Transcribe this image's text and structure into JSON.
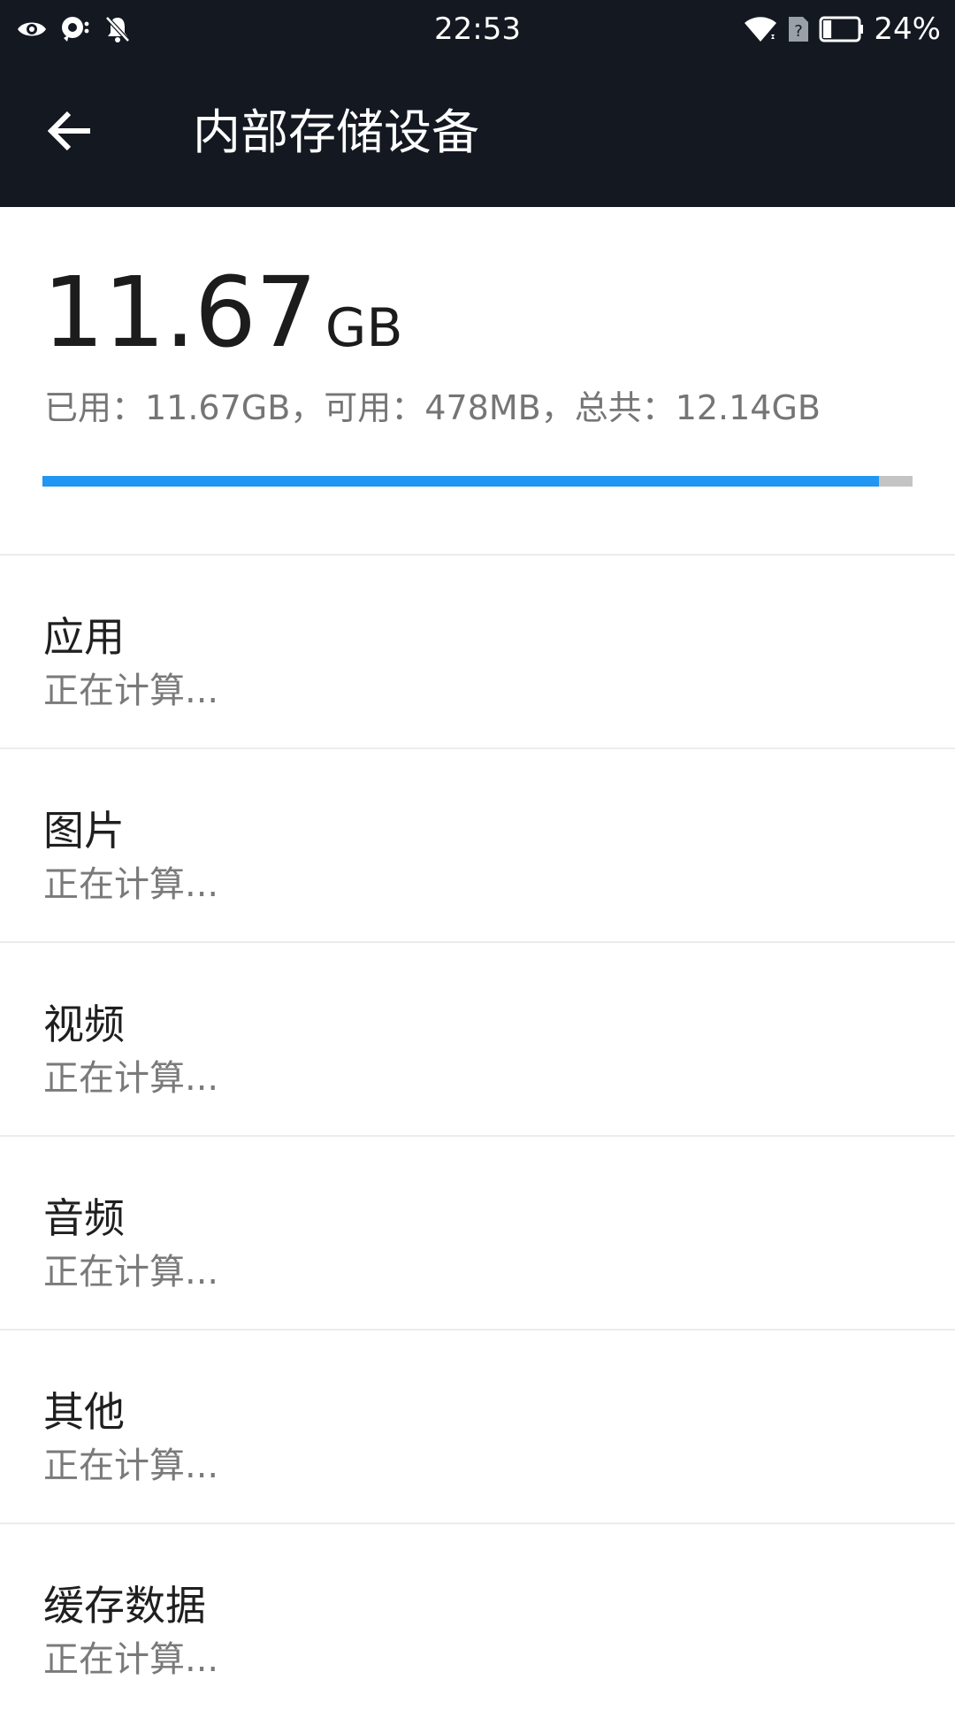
{
  "status_bar": {
    "time": "22:53",
    "battery_percent": "24%",
    "battery_level": 0.24,
    "left_icons": [
      "eye-icon",
      "data-saver-icon",
      "notifications-off-icon"
    ],
    "right_icons": [
      "wifi-icon",
      "no-sim-icon",
      "battery-icon"
    ]
  },
  "app_bar": {
    "back_icon": "arrow-back-icon",
    "title": "内部存储设备"
  },
  "summary": {
    "used_value": "11.67",
    "used_unit": "GB",
    "detail": "已用：11.67GB，可用：478MB，总共：12.14GB",
    "used_fraction": 0.961,
    "colors": {
      "progress_fill": "#2196f3",
      "progress_track": "#c4c4c4"
    }
  },
  "categories": [
    {
      "label": "应用",
      "status": "正在计算..."
    },
    {
      "label": "图片",
      "status": "正在计算..."
    },
    {
      "label": "视频",
      "status": "正在计算..."
    },
    {
      "label": "音频",
      "status": "正在计算..."
    },
    {
      "label": "其他",
      "status": "正在计算..."
    },
    {
      "label": "缓存数据",
      "status": "正在计算..."
    }
  ],
  "colors": {
    "app_bar_background": "#131821",
    "background": "#ffffff"
  }
}
